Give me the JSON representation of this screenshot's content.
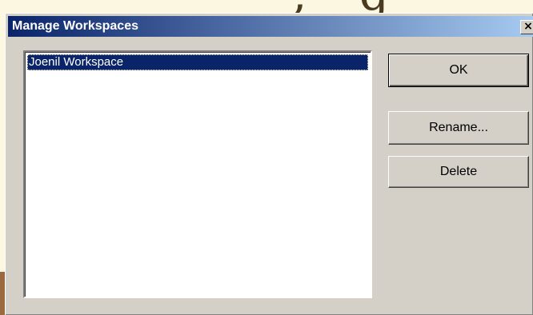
{
  "dialog": {
    "title": "Manage Workspaces",
    "close_glyph": "×"
  },
  "workspaces": {
    "items": [
      {
        "label": "Joenil Workspace",
        "selected": true
      }
    ]
  },
  "buttons": {
    "ok_label": "OK",
    "rename_label": "Rename...",
    "delete_label": "Delete"
  },
  "colors": {
    "titlebar_start": "#0a246a",
    "titlebar_end": "#a6caf0",
    "selection": "#0a246a",
    "dialog_face": "#d4d0c8"
  },
  "icons": {
    "close": "close-icon"
  }
}
